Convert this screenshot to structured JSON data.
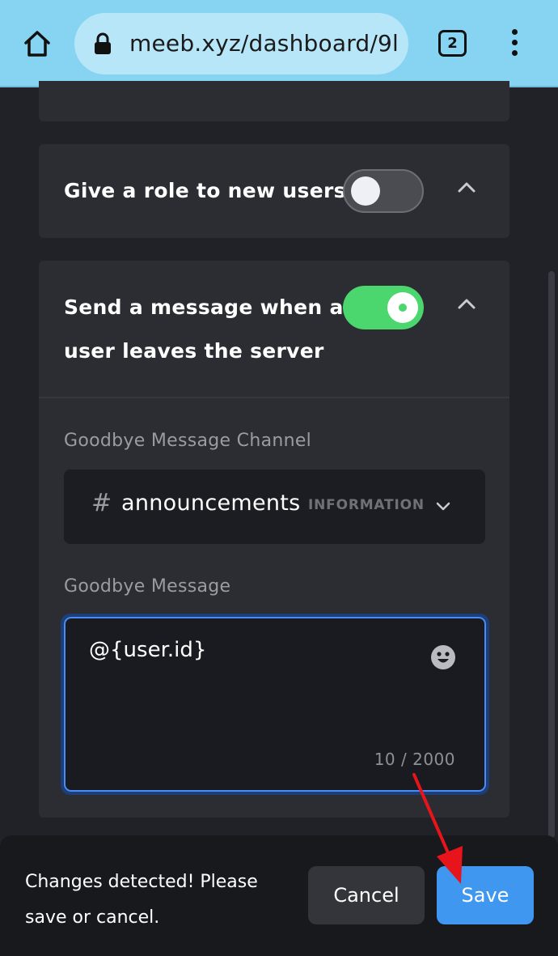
{
  "browser": {
    "url": "meeb.xyz/dashboard/9l",
    "tab_count": "2",
    "icons": [
      "home-icon",
      "lock-icon",
      "tabs-icon",
      "overflow-menu-icon"
    ]
  },
  "role_section": {
    "title": "Give a role to new users",
    "toggle_on": false
  },
  "leave_section": {
    "title_line1": "Send a message when a",
    "title_line2": "user leaves the server",
    "toggle_on": true,
    "channel_label": "Goodbye Message Channel",
    "channel_hash": "#",
    "channel_value": "announcements",
    "channel_category": "INFORMATION",
    "message_label": "Goodbye Message",
    "message_value": "@{user.id}",
    "char_count": "10 / 2000"
  },
  "save_bar": {
    "message": "Changes detected! Please save or cancel.",
    "cancel_label": "Cancel",
    "save_label": "Save"
  },
  "colors": {
    "browser_bar": "#87d3f2",
    "background": "#202228",
    "card": "#2b2d33",
    "toggle_on": "#4bd76e",
    "save_button": "#3f97f0",
    "annotation_arrow": "#e8141c"
  }
}
